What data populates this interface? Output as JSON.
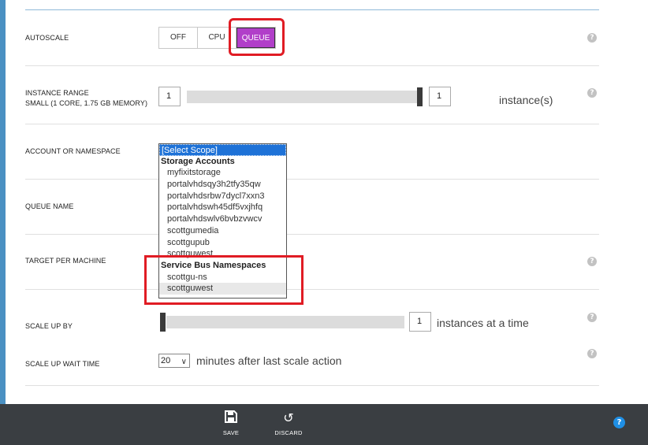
{
  "autoscale": {
    "label": "AUTOSCALE",
    "options": [
      "OFF",
      "CPU",
      "QUEUE"
    ],
    "selected": "QUEUE"
  },
  "instance_range": {
    "label_line1": "INSTANCE RANGE",
    "label_line2": "SMALL (1 CORE, 1.75 GB MEMORY)",
    "min_value": "1",
    "max_value": "1",
    "unit": "instance(s)"
  },
  "account": {
    "label": "ACCOUNT OR NAMESPACE",
    "items": [
      {
        "text": "[Select Scope]",
        "kind": "selected"
      },
      {
        "text": "Storage Accounts",
        "kind": "group"
      },
      {
        "text": "myfixitstorage",
        "kind": "option"
      },
      {
        "text": "portalvhdsqy3h2tfy35qw",
        "kind": "option"
      },
      {
        "text": "portalvhdsrbw7dycl7xxn3",
        "kind": "option"
      },
      {
        "text": "portalvhdswh45df5vxjhfq",
        "kind": "option"
      },
      {
        "text": "portalvhdswlv6bvbzvwcv",
        "kind": "option"
      },
      {
        "text": "scottgumedia",
        "kind": "option"
      },
      {
        "text": "scottgupub",
        "kind": "option"
      },
      {
        "text": "scottguwest",
        "kind": "option"
      },
      {
        "text": "Service Bus Namespaces",
        "kind": "group"
      },
      {
        "text": "scottgu-ns",
        "kind": "option"
      },
      {
        "text": "scottguwest",
        "kind": "hover"
      }
    ]
  },
  "queue_name": {
    "label": "QUEUE NAME"
  },
  "target": {
    "label": "TARGET PER MACHINE"
  },
  "scale_up": {
    "label": "SCALE UP BY",
    "value": "1",
    "unit": "instances at a time"
  },
  "wait": {
    "label": "SCALE UP WAIT TIME",
    "value": "20",
    "unit": "minutes after last scale action"
  },
  "footer": {
    "save": "SAVE",
    "discard": "DISCARD"
  },
  "help_glyph": "?",
  "colors": {
    "accent": "#b13fc9",
    "highlight": "#e01c24",
    "selection": "#1e72d7",
    "footer": "#3a3e42"
  }
}
